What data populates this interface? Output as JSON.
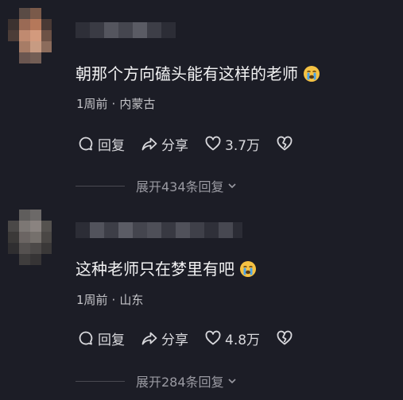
{
  "comments": [
    {
      "text": "朝那个方向磕头能有这样的老师",
      "emoji": "crying-face-icon",
      "time": "1周前",
      "dot": "·",
      "location": "内蒙古",
      "reply_label": "回复",
      "share_label": "分享",
      "likes": "3.7万",
      "expand_label": "展开434条回复"
    },
    {
      "text": "这种老师只在梦里有吧",
      "emoji": "crying-face-icon",
      "time": "1周前",
      "dot": "·",
      "location": "山东",
      "reply_label": "回复",
      "share_label": "分享",
      "likes": "4.8万",
      "expand_label": "展开284条回复"
    }
  ],
  "colors": {
    "background": "#1c1d26",
    "primary_text": "#f2f2f3",
    "secondary_text": "#c4c4c8",
    "muted_text": "#9a9aa2"
  }
}
